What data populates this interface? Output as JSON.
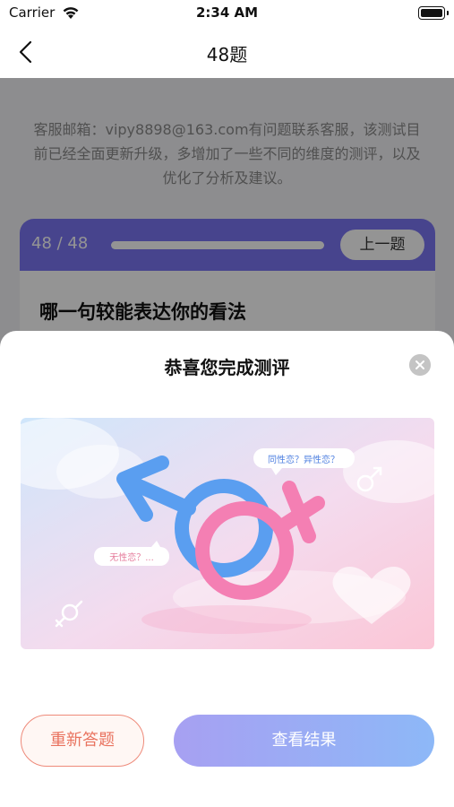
{
  "status_bar": {
    "carrier": "Carrier",
    "time": "2:34 AM"
  },
  "nav": {
    "title": "48题"
  },
  "notice": "客服邮箱：vipy8898@163.com有问题联系客服，该测试目前已经全面更新升级，多增加了一些不同的维度的测评，以及优化了分析及建议。",
  "question_card": {
    "counter": "48 / 48",
    "progress": 1.0,
    "prev_label": "上一题",
    "question_text": "哪一句较能表达你的看法"
  },
  "modal": {
    "title": "恭喜您完成测评",
    "illustration": {
      "bubble_top": "同性恋？异性恋？",
      "bubble_left": "无性恋？..."
    },
    "retry_label": "重新答题",
    "result_label": "查看结果"
  },
  "colors": {
    "accent_purple": "#7a75f3",
    "retry_red": "#e9735f",
    "result_gradient_start": "#a7a0f2",
    "result_gradient_end": "#8db8f7"
  },
  "icons": [
    "wifi-icon",
    "battery-icon",
    "back-chevron-icon",
    "close-icon",
    "male-symbol-icon",
    "female-symbol-icon"
  ]
}
